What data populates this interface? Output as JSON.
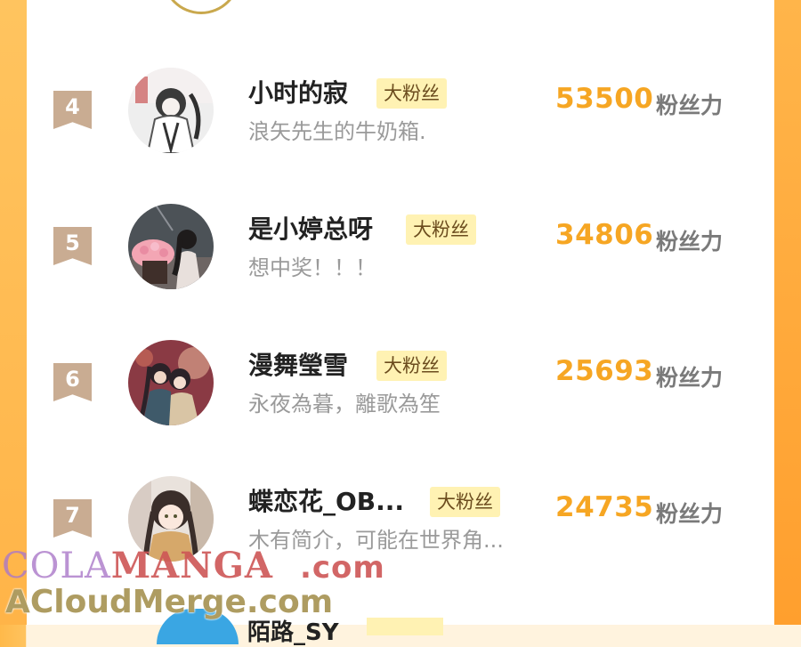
{
  "unit_label": "粉丝力",
  "rows": [
    {
      "rank": "4",
      "name": "小时的寂",
      "badge": "大粉丝",
      "bio": "浪矢先生的牛奶箱.",
      "score": "53500"
    },
    {
      "rank": "5",
      "name": "是小婷总呀",
      "badge": "大粉丝",
      "bio": "想中奖！！！",
      "score": "34806"
    },
    {
      "rank": "6",
      "name": "漫舞瑩雪",
      "badge": "大粉丝",
      "bio": "永夜為暮，離歌為笙",
      "score": "25693"
    },
    {
      "rank": "7",
      "name": "蝶恋花_OB...",
      "badge": "大粉丝",
      "bio": "木有简介，可能在世界角...",
      "score": "24735"
    }
  ],
  "partial_row": {
    "name": "陌路_SY"
  },
  "watermark": {
    "line1_a": "COLA",
    "line1_b": "MANGA",
    "line1_c": ".com",
    "line2": "ACloudMerge.com"
  },
  "colors": {
    "score": "#f6a623",
    "badge_bg": "#fff2b3",
    "rank_bg": "#c9ac92",
    "side": "#ffb448"
  }
}
